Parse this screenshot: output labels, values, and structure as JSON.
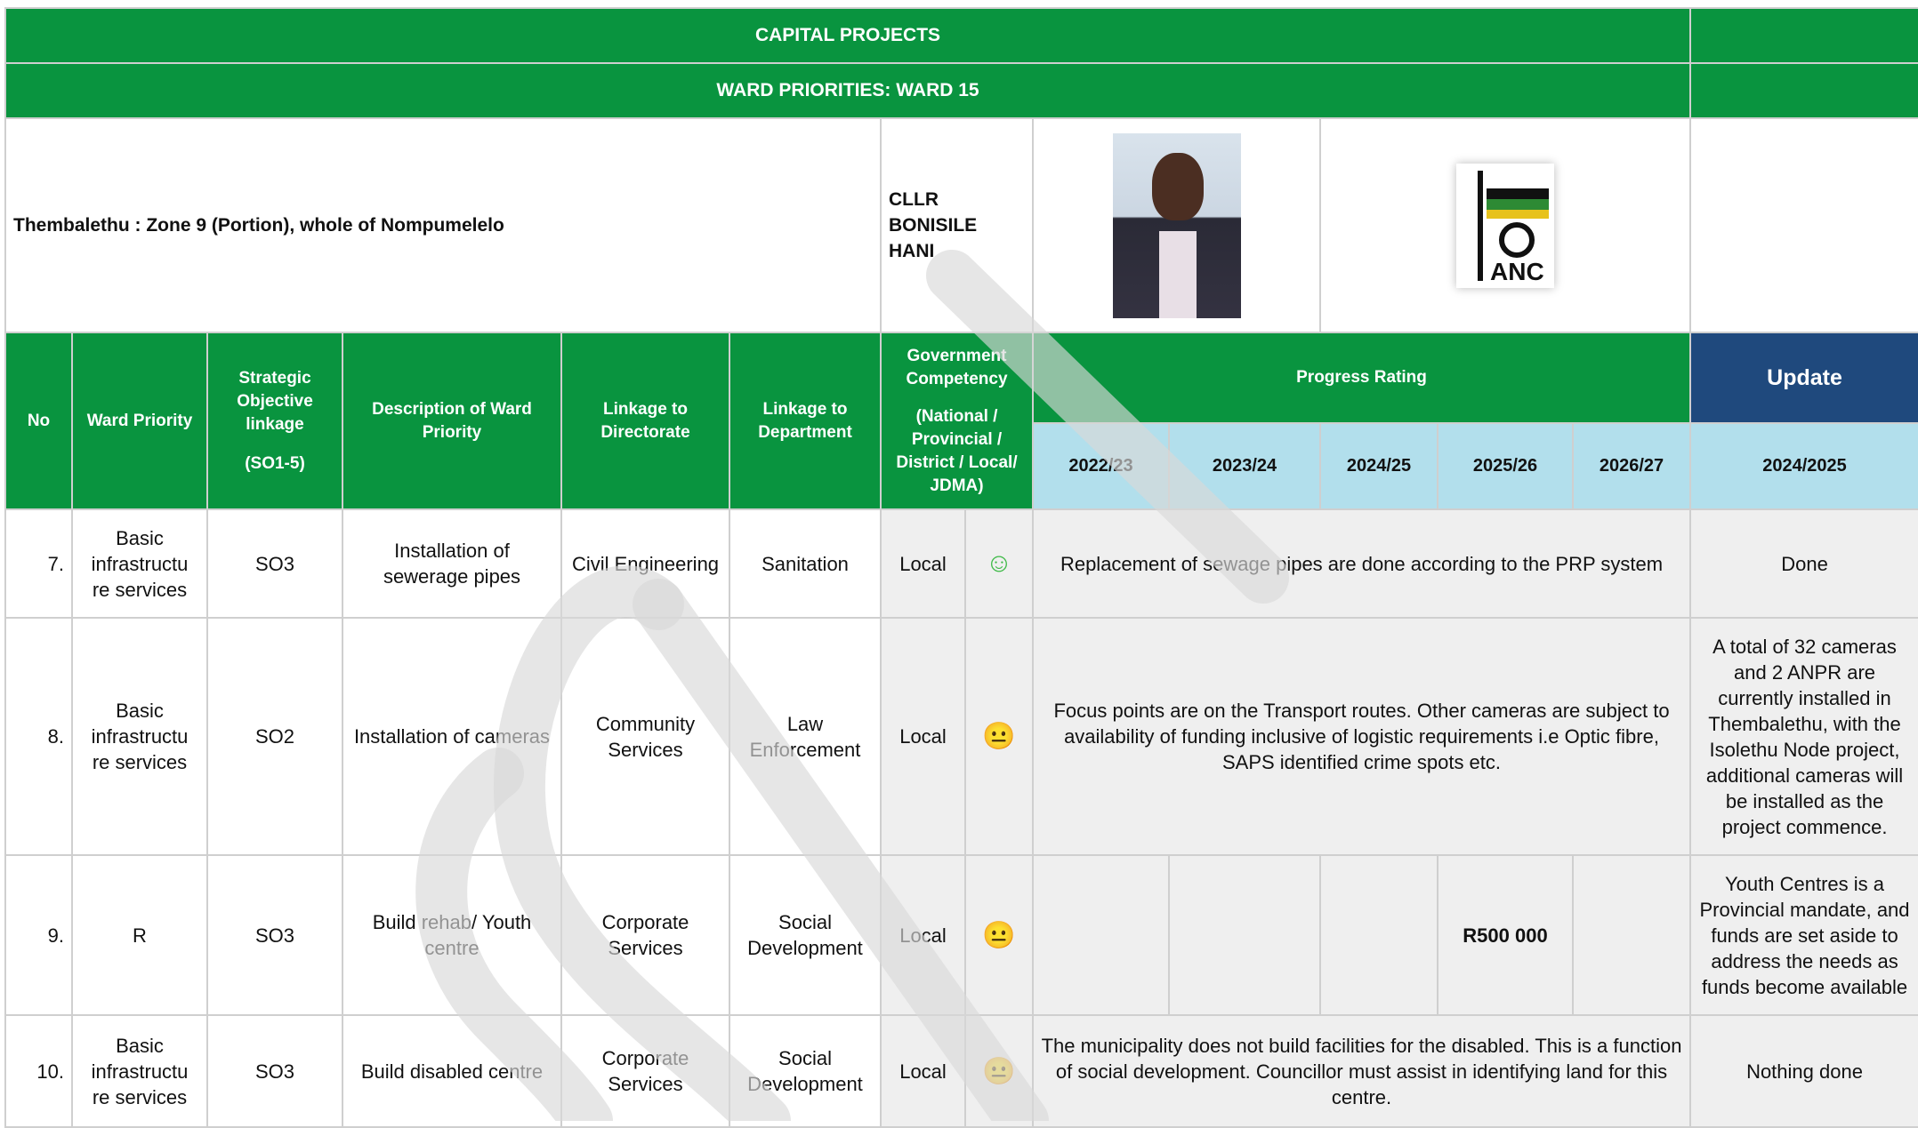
{
  "banner": {
    "title": "CAPITAL PROJECTS",
    "subtitle": "WARD PRIORITIES: WARD 15"
  },
  "ward": {
    "area": "Thembalethu : Zone 9 (Portion), whole of Nompumelelo",
    "councillor_line1": "CLLR BONISILE",
    "councillor_line2": "HANI",
    "party_logo_text": "ANC"
  },
  "headers": {
    "no": "No",
    "ward_priority": "Ward Priority",
    "so_line1": "Strategic Objective linkage",
    "so_line2": "(SO1-5)",
    "description": "Description of Ward Priority",
    "directorate": "Linkage to Directorate",
    "department": "Linkage to Department",
    "competency_line1": "Government Competency",
    "competency_line2": "(National / Provincial / District / Local/ JDMA)",
    "progress": "Progress Rating",
    "update": "Update",
    "years": [
      "2022/23",
      "2023/24",
      "2024/25",
      "2025/26",
      "2026/27"
    ],
    "update_year": "2024/2025"
  },
  "rows": [
    {
      "no": "7.",
      "priority": "Basic infrastructu re services",
      "so": "SO3",
      "description": "Installation of sewerage pipes",
      "directorate": "Civil Engineering",
      "department": "Sanitation",
      "competency": "Local",
      "status_icon": "smiley-happy-icon",
      "status_glyph": "☺",
      "progress_note": "Replacement of sewage pipes are done according to the PRP system",
      "update": "Done"
    },
    {
      "no": "8.",
      "priority": "Basic infrastructu re services",
      "so": "SO2",
      "description": "Installation of cameras",
      "directorate": "Community Services",
      "department": "Law Enforcement",
      "competency": "Local",
      "status_icon": "smiley-neutral-icon",
      "status_glyph": "😐",
      "progress_note": "Focus points are on the Transport routes. Other cameras are subject to availability of funding inclusive of logistic requirements i.e Optic fibre, SAPS identified crime spots etc.",
      "update": "A total of 32 cameras and 2 ANPR are currently installed in Thembalethu, with the Isolethu Node project, additional cameras will be installed as the project commence."
    },
    {
      "no": "9.",
      "priority": "R",
      "so": "SO3",
      "description": "Build rehab/ Youth centre",
      "directorate": "Corporate Services",
      "department": "Social Development",
      "competency": "Local",
      "status_icon": "smiley-neutral-icon",
      "status_glyph": "😐",
      "budget_2025_26": "R500 000",
      "update": "Youth Centres is a Provincial mandate, and funds are set aside to address the needs as funds become available"
    },
    {
      "no": "10.",
      "priority": "Basic infrastructu re services",
      "so": "SO3",
      "description": "Build disabled centre",
      "directorate": "Corporate Services",
      "department": "Social Development",
      "competency": "Local",
      "status_icon": "smiley-neutral-icon",
      "status_glyph": "😐",
      "progress_note": "The municipality does not build facilities for the disabled. This is a function of social development. Councillor must assist in identifying land for this centre.",
      "update": "Nothing done"
    }
  ],
  "colors": {
    "header_green": "#09943f",
    "year_band": "#b2dfec",
    "update_navy": "#1f497d",
    "happy": "#3fba48",
    "neutral": "#e9b43a",
    "watermark": "#d9d9d9"
  }
}
